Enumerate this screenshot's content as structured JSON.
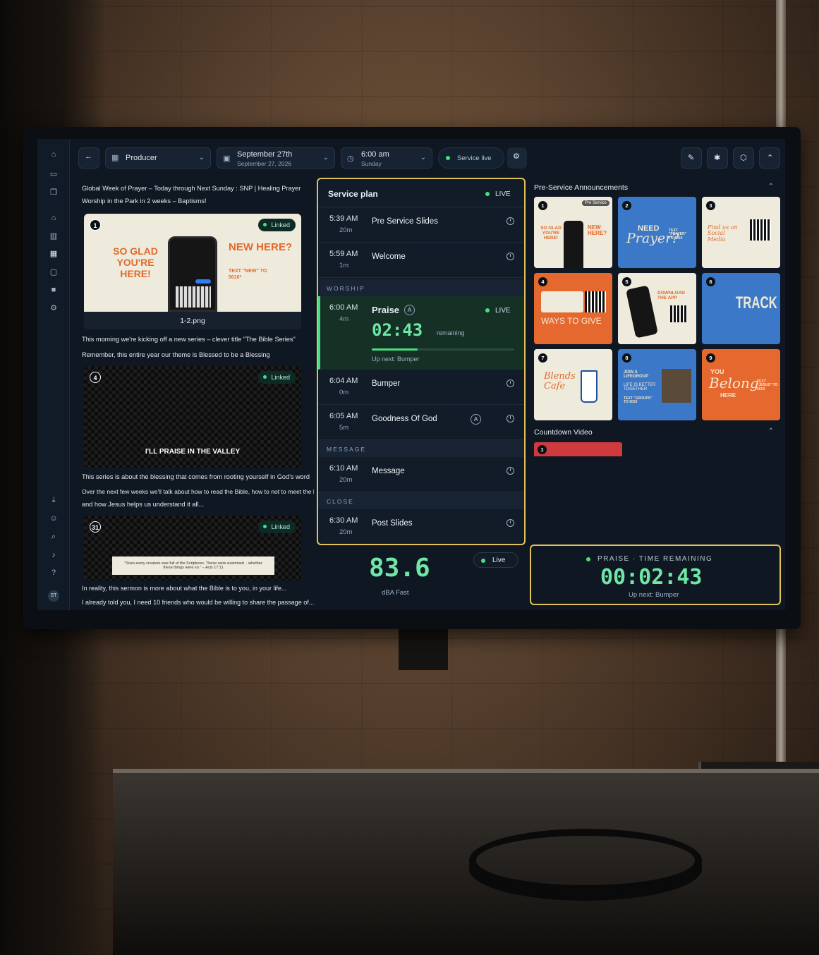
{
  "topbar": {
    "producer_label": "Producer",
    "date_label": "September 27th",
    "date_sub": "September 27, 2026",
    "time_label": "6:00 am",
    "time_sub": "Sunday",
    "service_live_label": "Service live"
  },
  "left": {
    "intro_line1": "Global Week of Prayer – Today through Next Sunday : SNP | Healing Prayer",
    "intro_line2": "Worship in the Park in 2 weeks – Baptisms!",
    "cards": [
      {
        "num": "1",
        "linked": "Linked",
        "filename": "1-2.png",
        "graphic_left": "SO GLAD YOU'RE HERE!",
        "graphic_right": "NEW HERE?",
        "graphic_right_sub": "TEXT \"NEW\" TO 5010*"
      },
      {
        "num": "4",
        "linked": "Linked",
        "slide_text": "I'LL PRAISE IN THE VALLEY"
      },
      {
        "num": "31",
        "linked": "Linked",
        "quote": "\"Scan every creature was full of the Scriptures. These were examined ...whether these things were so.\" – Acts 17:11"
      }
    ],
    "note1": "This morning we're kicking off a new series – clever title \"The Bible Series\"",
    "note2": "Remember, this entire year our theme is Blessed to be a Blessing",
    "note3": "This series is about the blessing that comes from rooting yourself in God's word",
    "note4": "Over the next few weeks we'll talk about how to read the Bible, how to not to meet the bible",
    "note5": "and how Jesus helps us understand it all...",
    "note6": "In reality, this sermon is more about what the Bible is to you, in your life...",
    "note7": "I already told you, I need 10 friends who would be willing to share the passage of..."
  },
  "plan": {
    "title": "Service plan",
    "live": "LIVE",
    "items": [
      {
        "time": "5:39 AM",
        "dur": "20m",
        "name": "Pre Service Slides"
      },
      {
        "time": "5:59 AM",
        "dur": "1m",
        "name": "Welcome"
      }
    ],
    "sec_worship": "WORSHIP",
    "current": {
      "time": "6:00 AM",
      "dur": "4m",
      "name": "Praise",
      "badge": "A",
      "live": "LIVE",
      "countdown": "02:43",
      "remaining": "remaining",
      "upnext": "Up next: Bumper",
      "progress": 0.32
    },
    "items2": [
      {
        "time": "6:04 AM",
        "dur": "0m",
        "name": "Bumper"
      },
      {
        "time": "6:05 AM",
        "dur": "5m",
        "name": "Goodness Of God",
        "badge": "A"
      }
    ],
    "sec_message": "MESSAGE",
    "message": {
      "time": "6:10 AM",
      "dur": "20m",
      "name": "Message"
    },
    "sec_close": "CLOSE",
    "post": {
      "time": "6:30 AM",
      "dur": "20m",
      "name": "Post Slides"
    }
  },
  "db": {
    "value": "83.6",
    "unit": "dBA Fast",
    "live": "Live"
  },
  "annc": {
    "title": "Pre-Service Announcements",
    "tiles": [
      {
        "n": "1",
        "tag": "Pre Service",
        "a": "SO GLAD YOU'RE HERE!",
        "b": "NEW HERE?"
      },
      {
        "n": "2",
        "a": "NEED",
        "b": "Prayer?",
        "c": "TEXT \"PRAYER\" TO 5010"
      },
      {
        "n": "3",
        "a": "Find us on Social Media"
      },
      {
        "n": "4",
        "a": "WAYS TO GIVE"
      },
      {
        "n": "5",
        "a": "DOWNLOAD THE APP"
      },
      {
        "n": "6",
        "a": "TRACK"
      },
      {
        "n": "7",
        "a": "Blends Cafe"
      },
      {
        "n": "8",
        "a": "JOIN A LIFEGROUP",
        "b": "LIFE IS BETTER TOGETHER",
        "c": "TEXT \"GROUPS\" TO 5010"
      },
      {
        "n": "9",
        "a": "YOU",
        "b": "Belong",
        "c": "HERE",
        "d": "TEXT \"JESUS\" TO 5010"
      }
    ],
    "countdown_title": "Countdown Video",
    "countdown_num": "1"
  },
  "timer": {
    "label": "PRAISE · TIME REMAINING",
    "value": "00:02:43",
    "upnext": "Up next: Bumper"
  },
  "rail": {
    "avatar": "ST"
  }
}
